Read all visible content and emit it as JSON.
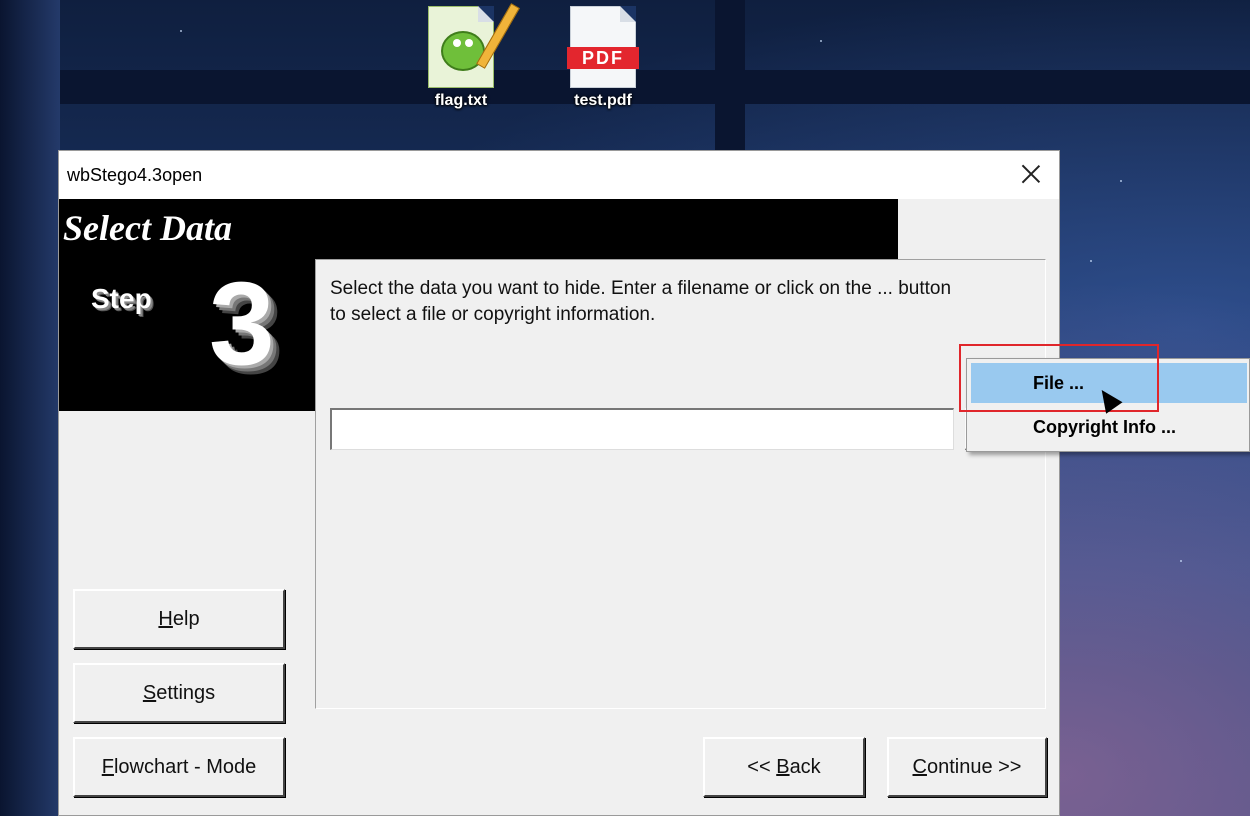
{
  "desktop": {
    "icons": [
      {
        "label": "flag.txt",
        "icon": "notepad-plus-plus-file-icon"
      },
      {
        "label": "test.pdf",
        "icon": "pdf-file-icon",
        "badge": "PDF"
      }
    ]
  },
  "window": {
    "title": "wbStego4.3open",
    "heading": "Select Data",
    "step_label": "Step",
    "step_number": "3",
    "instructions": "Select the data you want to hide. Enter a filename or click on the ... button to select a file or copyright information.",
    "filename_value": "",
    "buttons": {
      "help": {
        "mnemonic": "H",
        "rest": "elp"
      },
      "settings": {
        "mnemonic": "S",
        "rest": "ettings"
      },
      "flowchart": {
        "mnemonic": "F",
        "rest": "lowchart - Mode"
      },
      "back": {
        "prefix": "<< ",
        "mnemonic": "B",
        "rest": "ack"
      },
      "continue": {
        "mnemonic": "C",
        "rest": "ontinue >>"
      }
    }
  },
  "popup_menu": {
    "items": [
      {
        "label": "File ...",
        "active": true
      },
      {
        "label": "Copyright Info ...",
        "active": false
      }
    ]
  },
  "colors": {
    "menu_highlight": "#99c9ef",
    "annotation_box": "#e0262b"
  }
}
